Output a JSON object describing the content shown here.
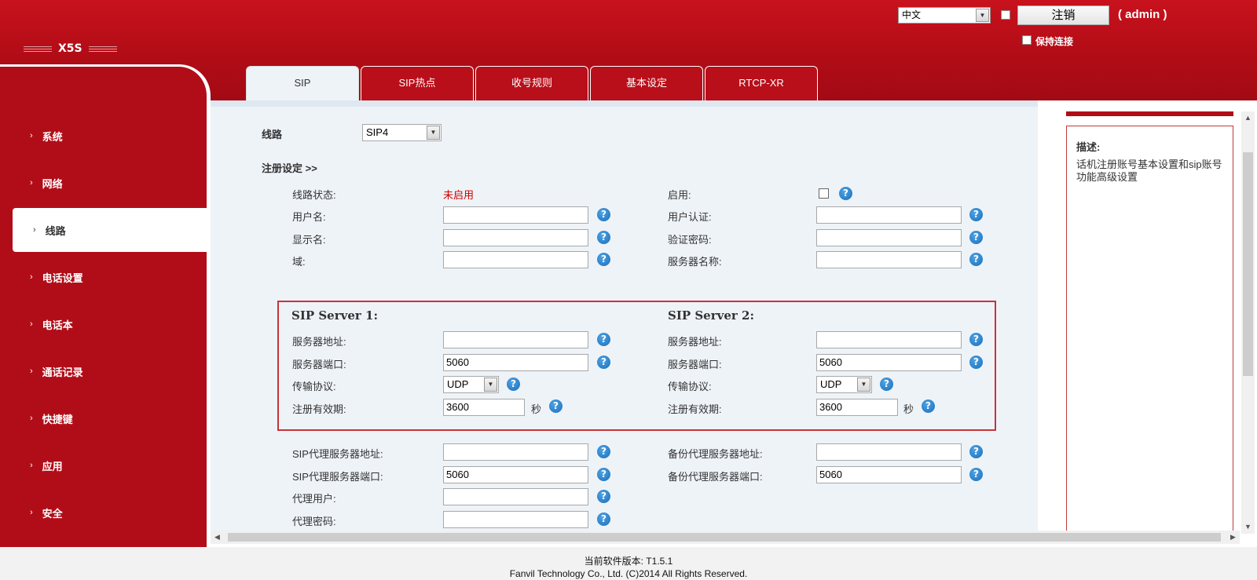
{
  "header": {
    "logo": "X5S",
    "language": "中文",
    "logout_label": "注销",
    "user": "( admin )",
    "keep_connected": "保持连接"
  },
  "tabs": [
    {
      "label": "SIP",
      "active": true
    },
    {
      "label": "SIP热点",
      "active": false
    },
    {
      "label": "收号规则",
      "active": false
    },
    {
      "label": "基本设定",
      "active": false
    },
    {
      "label": "RTCP-XR",
      "active": false
    }
  ],
  "sidebar": {
    "items": [
      {
        "label": "系统"
      },
      {
        "label": "网络"
      },
      {
        "label": "线路",
        "active": true
      },
      {
        "label": "电话设置"
      },
      {
        "label": "电话本"
      },
      {
        "label": "通话记录"
      },
      {
        "label": "快捷键"
      },
      {
        "label": "应用"
      },
      {
        "label": "安全"
      }
    ]
  },
  "form": {
    "line_label": "线路",
    "line_value": "SIP4",
    "reg_settings": "注册设定 >>",
    "line_status_label": "线路状态:",
    "line_status_value": "未启用",
    "enable_label": "启用:",
    "username_label": "用户名:",
    "username_value": "",
    "auth_user_label": "用户认证:",
    "auth_user_value": "",
    "display_name_label": "显示名:",
    "display_name_value": "",
    "auth_password_label": "验证密码:",
    "auth_password_value": "",
    "domain_label": "域:",
    "domain_value": "",
    "server_name_label": "服务器名称:",
    "server_name_value": "",
    "server1": {
      "title": "SIP Server 1:",
      "address_label": "服务器地址:",
      "address_value": "",
      "port_label": "服务器端口:",
      "port_value": "5060",
      "transport_label": "传输协议:",
      "transport_value": "UDP",
      "expiry_label": "注册有效期:",
      "expiry_value": "3600",
      "unit": "秒"
    },
    "server2": {
      "title": "SIP Server 2:",
      "address_label": "服务器地址:",
      "address_value": "",
      "port_label": "服务器端口:",
      "port_value": "5060",
      "transport_label": "传输协议:",
      "transport_value": "UDP",
      "expiry_label": "注册有效期:",
      "expiry_value": "3600",
      "unit": "秒"
    },
    "proxy_addr_label": "SIP代理服务器地址:",
    "proxy_addr_value": "",
    "backup_proxy_addr_label": "备份代理服务器地址:",
    "backup_proxy_addr_value": "",
    "proxy_port_label": "SIP代理服务器端口:",
    "proxy_port_value": "5060",
    "backup_proxy_port_label": "备份代理服务器端口:",
    "backup_proxy_port_value": "5060",
    "proxy_user_label": "代理用户:",
    "proxy_user_value": "",
    "proxy_password_label": "代理密码:",
    "proxy_password_value": ""
  },
  "description": {
    "title": "描述:",
    "text": "话机注册账号基本设置和sip账号功能高级设置"
  },
  "footer": {
    "version": "当前软件版本: T1.5.1",
    "copyright": "Fanvil Technology Co., Ltd. (C)2014 All Rights Reserved."
  },
  "colors": {
    "brand_red": "#b10d18",
    "pane_bg": "#eef3f8",
    "help_blue": "#1a6fb8"
  }
}
